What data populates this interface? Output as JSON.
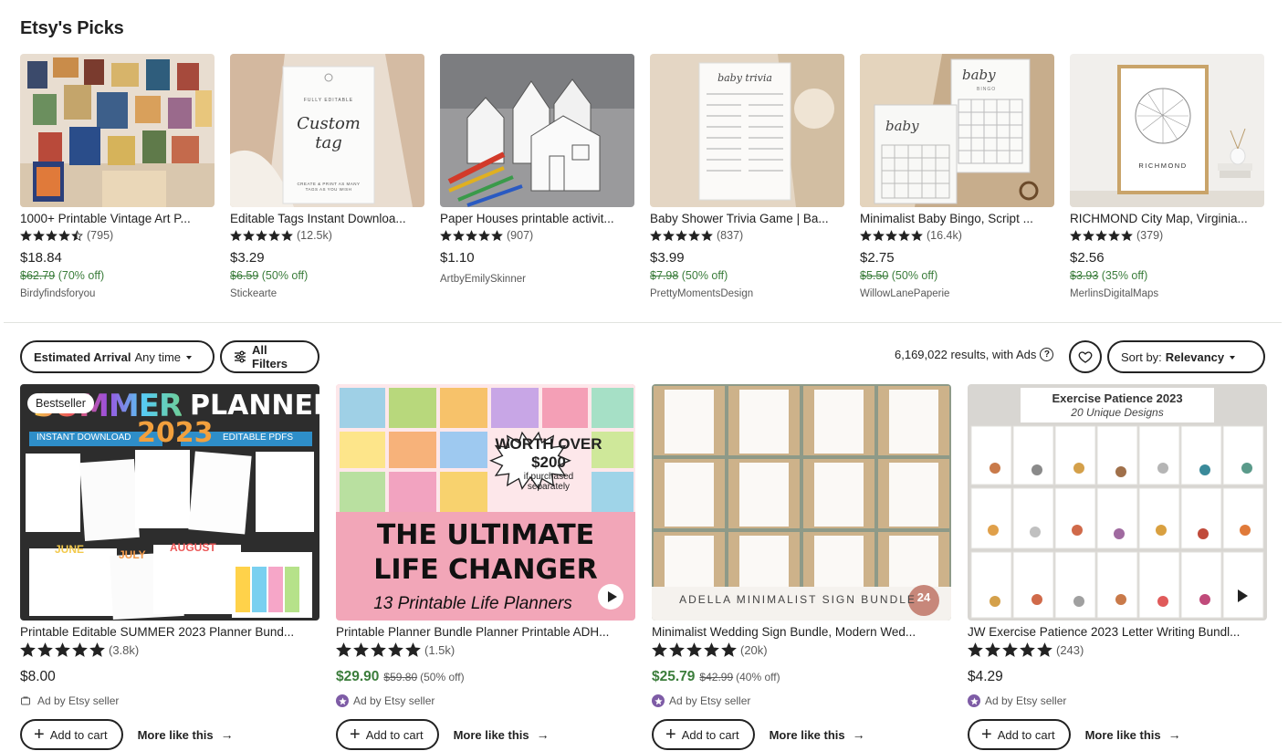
{
  "picks": {
    "title": "Etsy's Picks",
    "items": [
      {
        "title": "1000+ Printable Vintage Art P...",
        "rating": 4.5,
        "reviews": "(795)",
        "price": "$18.84",
        "original": "$62.79",
        "discount": "(70% off)",
        "shop": "Birdyfindsforyou"
      },
      {
        "title": "Editable Tags Instant Downloa...",
        "rating": 5,
        "reviews": "(12.5k)",
        "price": "$3.29",
        "original": "$6.59",
        "discount": "(50% off)",
        "shop": "Stickearte"
      },
      {
        "title": "Paper Houses printable activit...",
        "rating": 5,
        "reviews": "(907)",
        "price": "$1.10",
        "original": "",
        "discount": "",
        "shop": "ArtbyEmilySkinner"
      },
      {
        "title": "Baby Shower Trivia Game | Ba...",
        "rating": 5,
        "reviews": "(837)",
        "price": "$3.99",
        "original": "$7.98",
        "discount": "(50% off)",
        "shop": "PrettyMomentsDesign"
      },
      {
        "title": "Minimalist Baby Bingo, Script ...",
        "rating": 5,
        "reviews": "(16.4k)",
        "price": "$2.75",
        "original": "$5.50",
        "discount": "(50% off)",
        "shop": "WillowLanePaperie"
      },
      {
        "title": "RICHMOND City Map, Virginia...",
        "rating": 5,
        "reviews": "(379)",
        "price": "$2.56",
        "original": "$3.93",
        "discount": "(35% off)",
        "shop": "MerlinsDigitalMaps"
      }
    ],
    "image_text": {
      "tag_title": "Custom tag",
      "tag_top": "FULLY EDITABLE",
      "tag_bottom": "CREATE & PRINT AS MANY TAGS AS YOU WISH",
      "trivia": "baby trivia",
      "bingo_a": "baby",
      "bingo_b": "baby",
      "bingo_word": "BINGO",
      "map_city": "RICHMOND"
    }
  },
  "filters": {
    "arrival_label": "Estimated Arrival",
    "arrival_value": "Any time",
    "all_filters": "All Filters",
    "results": "6,169,022 results, with Ads",
    "help": "?",
    "sort_label": "Sort by:",
    "sort_value": "Relevancy"
  },
  "listings": [
    {
      "title": "Printable Editable SUMMER 2023 Planner Bund...",
      "badge": "Bestseller",
      "rating": 5,
      "reviews": "(3.8k)",
      "price": "$8.00",
      "original": "",
      "discount": "",
      "ad": "Ad by Etsy seller",
      "star_seller": false,
      "video": false,
      "img": {
        "l1": "SUMMER",
        "l2": "PLANNER",
        "l3": "INSTANT DOWNLOAD",
        "l4": "2023",
        "l5": "EDITABLE PDFS",
        "june": "JUNE",
        "july": "JULY",
        "august": "AUGUST"
      }
    },
    {
      "title": "Printable Planner Bundle Planner Printable ADH...",
      "badge": "",
      "rating": 5,
      "reviews": "(1.5k)",
      "price": "$29.90",
      "original": "$59.80",
      "discount": "(50% off)",
      "ad": "Ad by Etsy seller",
      "star_seller": true,
      "video": true,
      "img": {
        "worth": "WORTH OVER $200",
        "worth_sub": "if purchased separately",
        "big1": "THE ULTIMATE",
        "big2": "LIFE CHANGER",
        "sub": "13 Printable Life Planners"
      }
    },
    {
      "title": "Minimalist Wedding Sign Bundle, Modern Wed...",
      "badge": "",
      "rating": 5,
      "reviews": "(20k)",
      "price": "$25.79",
      "original": "$42.99",
      "discount": "(40% off)",
      "ad": "Ad by Etsy seller",
      "star_seller": true,
      "video": false,
      "img": {
        "caption": "ADELLA MINIMALIST SIGN BUNDLE",
        "num": "24"
      }
    },
    {
      "title": "JW Exercise Patience 2023 Letter Writing Bundl...",
      "badge": "",
      "rating": 5,
      "reviews": "(243)",
      "price": "$4.29",
      "original": "",
      "discount": "",
      "ad": "Ad by Etsy seller",
      "star_seller": true,
      "video": true,
      "img": {
        "t1": "Exercise Patience 2023",
        "t2": "20 Unique Designs"
      }
    }
  ],
  "actions": {
    "add_to_cart": "Add to cart",
    "more_like_this": "More like this"
  },
  "colors": {
    "sale_green": "#3b7d3b",
    "star_seller_purple": "#7e5ca6",
    "text": "#222222",
    "muted": "#595959"
  }
}
